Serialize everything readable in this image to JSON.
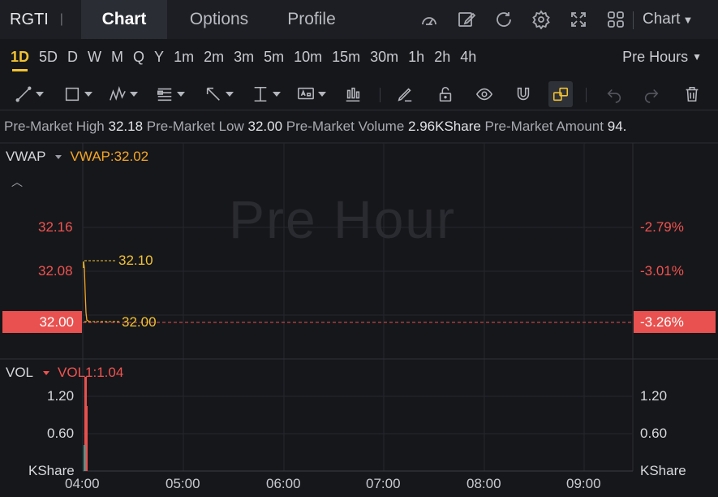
{
  "header": {
    "ticker": "RGTI",
    "separator": "|",
    "tabs": [
      {
        "label": "Chart",
        "active": true
      },
      {
        "label": "Options",
        "active": false
      },
      {
        "label": "Profile",
        "active": false
      }
    ],
    "icons": [
      "gauge-icon",
      "edit-icon",
      "refresh-icon",
      "settings-icon",
      "fullscreen-icon",
      "grid-layout-icon"
    ],
    "chart_dropdown": "Chart"
  },
  "intervals": {
    "items": [
      "1D",
      "5D",
      "D",
      "W",
      "M",
      "Q",
      "Y",
      "1m",
      "2m",
      "3m",
      "5m",
      "10m",
      "15m",
      "30m",
      "1h",
      "2h",
      "4h"
    ],
    "active": "1D",
    "session_dropdown": "Pre Hours"
  },
  "info_line": {
    "high_label": "Pre-Market High",
    "high_value": "32.18",
    "low_label": "Pre-Market Low",
    "low_value": "32.00",
    "volume_label": "Pre-Market Volume",
    "volume_value": "2.96KShare",
    "amount_label": "Pre-Market Amount",
    "amount_value": "94."
  },
  "price_pane": {
    "indicator_name": "VWAP",
    "indicator_value": "VWAP:32.02",
    "watermark": "Pre Hour",
    "y_left_ticks": [
      "32.16",
      "32.08"
    ],
    "y_right_ticks": [
      "-2.79%",
      "-3.01%"
    ],
    "current_price": "32.00",
    "current_pct": "-3.26%",
    "high_marker": "32.10",
    "low_marker": "32.00"
  },
  "volume_pane": {
    "indicator_name": "VOL",
    "indicator_value": "VOL1:1.04",
    "y_left_ticks": [
      "1.20",
      "0.60",
      "KShare"
    ],
    "y_right_ticks": [
      "1.20",
      "0.60",
      "KShare"
    ]
  },
  "x_axis": [
    "04:00",
    "05:00",
    "06:00",
    "07:00",
    "08:00",
    "09:00"
  ],
  "colors": {
    "accent": "#f2c230",
    "down": "#e8514f",
    "up": "#26a69a",
    "vwap": "#f5a623",
    "background": "#16171b"
  }
}
